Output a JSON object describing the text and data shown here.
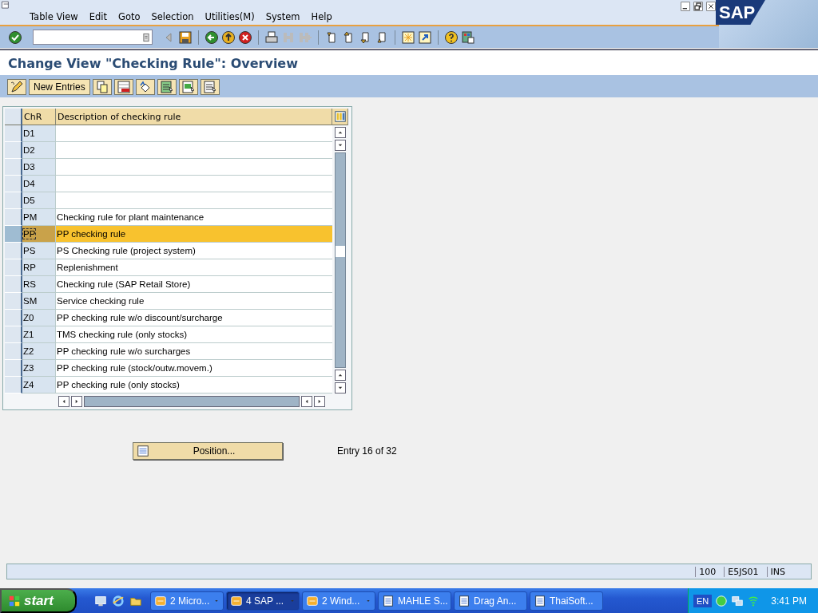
{
  "window": {
    "menu": [
      "Table View",
      "Edit",
      "Goto",
      "Selection",
      "Utilities(M)",
      "System",
      "Help"
    ],
    "logo": "SAP"
  },
  "title": "Change View \"Checking Rule\": Overview",
  "app_toolbar": {
    "new_entries": "New Entries"
  },
  "table": {
    "columns": [
      "ChR",
      "Description of checking rule"
    ],
    "rows": [
      {
        "chr": "D1",
        "selected": false
      },
      {
        "chr": "D2",
        "selected": false
      },
      {
        "chr": "D3",
        "selected": false
      },
      {
        "chr": "D4",
        "selected": false
      },
      {
        "chr": "D5",
        "selected": false
      },
      {
        "chr": "PM",
        "description": "Checking rule for plant maintenance",
        "selected": false
      },
      {
        "chr": "PP",
        "description": "PP checking rule",
        "selected": true
      },
      {
        "chr": "PS",
        "description": "PS Checking rule (project system)",
        "selected": false
      },
      {
        "chr": "RP",
        "description": "Replenishment",
        "selected": false
      },
      {
        "chr": "RS",
        "description": "Checking rule (SAP Retail Store)",
        "selected": false
      },
      {
        "chr": "SM",
        "description": "Service checking rule",
        "selected": false
      },
      {
        "chr": "Z0",
        "description": "PP checking rule w/o discount/surcharge",
        "selected": false
      },
      {
        "chr": "Z1",
        "description": "TMS checking rule (only stocks)",
        "selected": false
      },
      {
        "chr": "Z2",
        "description": "PP checking rule w/o  surcharges",
        "selected": false
      },
      {
        "chr": "Z3",
        "description": "PP checking rule (stock/outw.movem.)",
        "selected": false
      },
      {
        "chr": "Z4",
        "description": "PP checking rule (only stocks)",
        "selected": false
      }
    ]
  },
  "position_button": "Position...",
  "entry_info": "Entry 16 of 32",
  "status_bar": {
    "fields": [
      "100",
      "E5JS01",
      "INS"
    ]
  },
  "taskbar": {
    "start": "start",
    "tasks": [
      {
        "label": "2 Micro...",
        "selected": false,
        "group": true
      },
      {
        "label": "4 SAP ...",
        "selected": true,
        "group": true
      },
      {
        "label": "2 Wind...",
        "selected": false,
        "group": true
      },
      {
        "label": "MAHLE S...",
        "selected": false,
        "group": false
      },
      {
        "label": "Drag An...",
        "selected": false,
        "group": false
      },
      {
        "label": "ThaiSoft...",
        "selected": false,
        "group": false
      }
    ],
    "language": "EN",
    "clock": "3:41 PM"
  }
}
